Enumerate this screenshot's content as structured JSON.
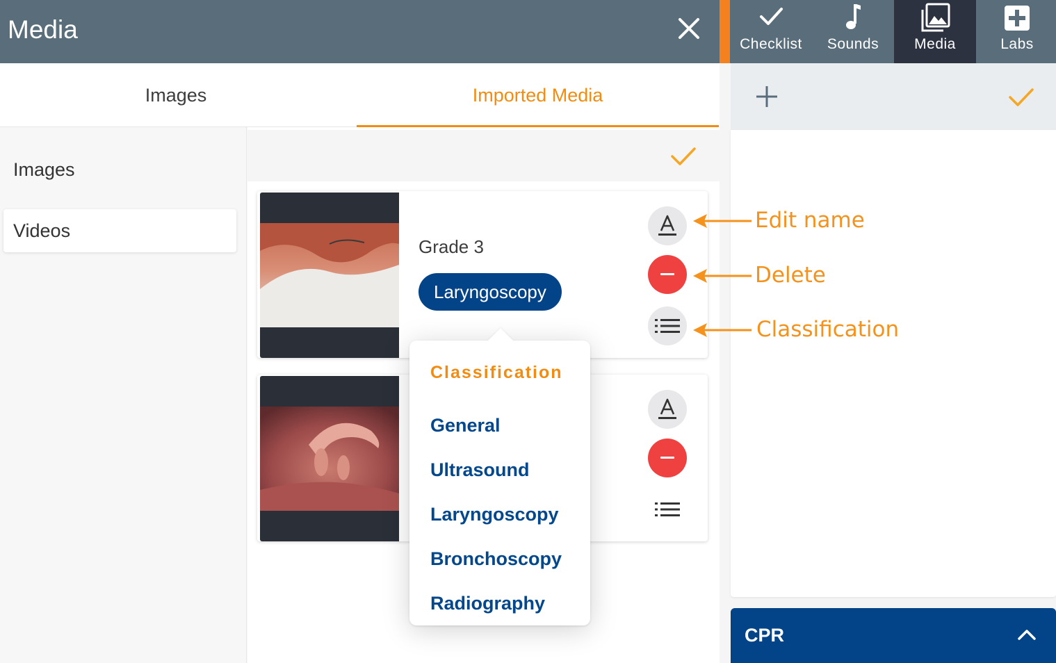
{
  "panel": {
    "title": "Media"
  },
  "tabs": [
    {
      "label": "Images",
      "active": false
    },
    {
      "label": "Imported Media",
      "active": true
    }
  ],
  "sidebar": {
    "items": [
      {
        "label": "Images",
        "selected": false
      },
      {
        "label": "Videos",
        "selected": true
      }
    ]
  },
  "cards": [
    {
      "name": "Grade 3",
      "classification": "Laryngoscopy"
    },
    {
      "name": "",
      "classification": ""
    }
  ],
  "popover": {
    "title": "Classification",
    "options": [
      "General",
      "Ultrasound",
      "Laryngoscopy",
      "Bronchoscopy",
      "Radiography"
    ]
  },
  "nav": {
    "items": [
      {
        "label": "Checklist",
        "icon": "checkmark-icon"
      },
      {
        "label": "Sounds",
        "icon": "music-note-icon"
      },
      {
        "label": "Media",
        "icon": "photo-library-icon",
        "active": true
      },
      {
        "label": "Labs",
        "icon": "medical-cross-icon"
      }
    ]
  },
  "cpr": {
    "label": "CPR"
  },
  "annotations": {
    "edit_name": "Edit name",
    "delete": "Delete",
    "classification": "Classification"
  },
  "colors": {
    "header": "#596e7a",
    "accent": "#f28c10",
    "brand_blue": "#034488",
    "danger": "#f04141",
    "nav_active": "#2d3240"
  }
}
